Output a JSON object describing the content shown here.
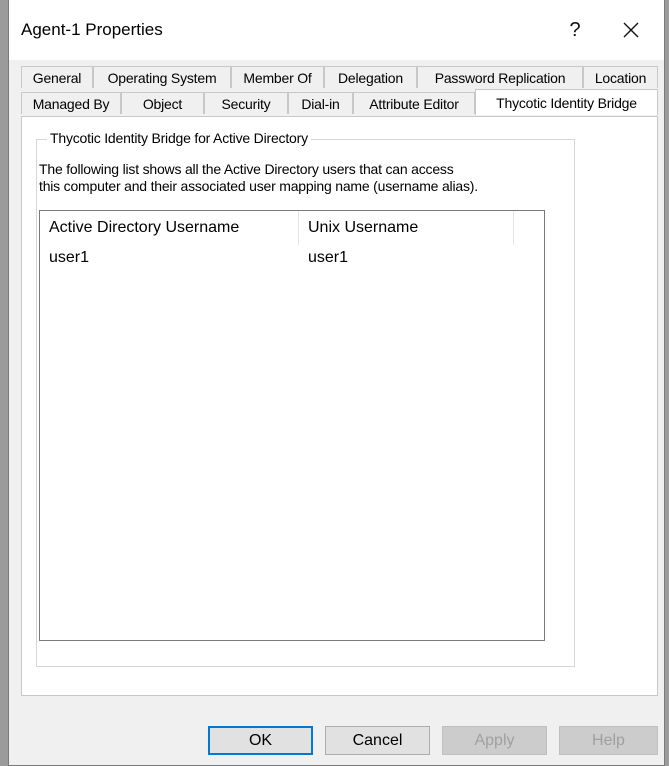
{
  "window": {
    "title": "Agent-1 Properties",
    "help_glyph": "?",
    "close_icon": "close-icon"
  },
  "tabs": {
    "row1": [
      "General",
      "Operating System",
      "Member Of",
      "Delegation",
      "Password Replication",
      "Location"
    ],
    "row2": [
      "Managed By",
      "Object",
      "Security",
      "Dial-in",
      "Attribute Editor",
      "Thycotic Identity Bridge"
    ],
    "active": "Thycotic Identity Bridge"
  },
  "group": {
    "label": "Thycotic Identity Bridge for Active Directory",
    "description_line1": "The following list shows all the Active Directory users that can access",
    "description_line2": "this computer and their associated user mapping name (username alias)."
  },
  "list": {
    "columns": [
      "Active Directory Username",
      "Unix Username"
    ],
    "rows": [
      [
        "user1",
        "user1"
      ]
    ]
  },
  "buttons": {
    "ok": "OK",
    "cancel": "Cancel",
    "apply": "Apply",
    "help": "Help"
  },
  "colors": {
    "default_button_border": "#0078d7",
    "dialog_background": "#f0f0f0"
  }
}
